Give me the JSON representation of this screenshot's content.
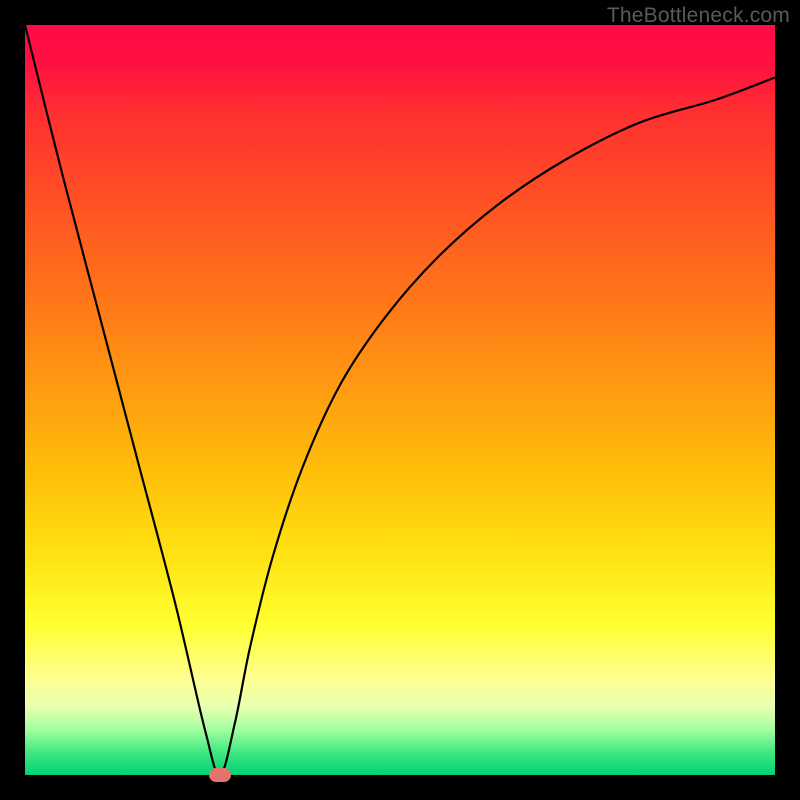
{
  "watermark": "TheBottleneck.com",
  "chart_data": {
    "type": "line",
    "title": "",
    "xlabel": "",
    "ylabel": "",
    "xlim": [
      0,
      100
    ],
    "ylim": [
      0,
      100
    ],
    "gradient_meaning": "vertical color gradient red (high/bad) to green (low/good)",
    "marker": {
      "x": 26,
      "y": 0
    },
    "series": [
      {
        "name": "bottleneck-curve",
        "x": [
          0,
          5,
          10,
          15,
          20,
          24,
          26,
          28,
          30,
          33,
          37,
          42,
          48,
          55,
          63,
          72,
          82,
          92,
          100
        ],
        "values": [
          100,
          80,
          61,
          42,
          23,
          6,
          0,
          7,
          17,
          29,
          41,
          52,
          61,
          69,
          76,
          82,
          87,
          90,
          93
        ]
      }
    ]
  }
}
